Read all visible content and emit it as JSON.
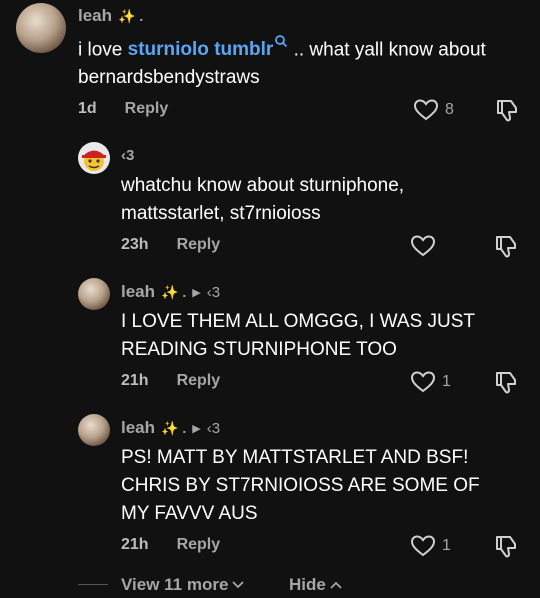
{
  "comments": [
    {
      "author": "leah",
      "author_suffix": "✨ .",
      "text_before": "i love ",
      "mention": "sturniolo tumblr",
      "text_after": " .. what yall know about bernardsbendystraws",
      "time": "1d",
      "reply_label": "Reply",
      "likes": "8"
    },
    {
      "author": "‹3",
      "text": "whatchu know about sturniphone, mattsstarlet, st7rnioioss",
      "time": "23h",
      "reply_label": "Reply",
      "likes": ""
    },
    {
      "author": "leah",
      "author_suffix": "✨ .",
      "reply_to": "‹3",
      "text": "I LOVE THEM ALL OMGGG, I WAS JUST READING STURNIPHONE TOO",
      "time": "21h",
      "reply_label": "Reply",
      "likes": "1"
    },
    {
      "author": "leah",
      "author_suffix": "✨ .",
      "reply_to": "‹3",
      "text": "PS! MATT BY MATTSTARLET AND BSF! CHRIS BY ST7RNIOIOSS ARE SOME OF MY FAVVV AUS",
      "time": "21h",
      "reply_label": "Reply",
      "likes": "1"
    }
  ],
  "footer": {
    "view_more": "View 11 more",
    "hide": "Hide"
  },
  "colors": {
    "background": "#111111",
    "mention": "#5aa6f5",
    "muted": "#a6a6a6"
  }
}
